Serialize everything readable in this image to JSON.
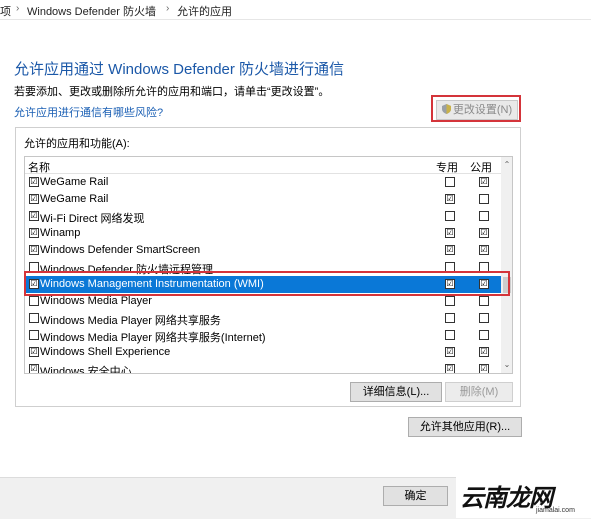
{
  "breadcrumb": [
    "项",
    "Windows Defender 防火墙",
    "允许的应用"
  ],
  "page_title": "允许应用通过 Windows Defender 防火墙进行通信",
  "subtitle": "若要添加、更改或删除所允许的应用和端口，请单击“更改设置”。",
  "risk_link": "允许应用进行通信有哪些风险?",
  "change_settings_label": "更改设置(N)",
  "group_label": "允许的应用和功能(A):",
  "columns": {
    "name": "名称",
    "private": "专用",
    "public": "公用"
  },
  "rows": [
    {
      "name": "WeGame Rail",
      "enabled": "☑",
      "private": "",
      "public": "☑"
    },
    {
      "name": "WeGame Rail",
      "enabled": "☑",
      "private": "☑",
      "public": ""
    },
    {
      "name": "Wi-Fi Direct 网络发现",
      "enabled": "☑",
      "private": "",
      "public": ""
    },
    {
      "name": "Winamp",
      "enabled": "☑",
      "private": "☑",
      "public": "☑"
    },
    {
      "name": "Windows Defender SmartScreen",
      "enabled": "☑",
      "private": "☑",
      "public": "☑"
    },
    {
      "name": "Windows Defender 防火墙远程管理",
      "enabled": "",
      "private": "",
      "public": ""
    },
    {
      "name": "Windows Management Instrumentation (WMI)",
      "enabled": "☑",
      "private": "☑",
      "public": "☑",
      "selected": true
    },
    {
      "name": "Windows Media Player",
      "enabled": "",
      "private": "",
      "public": ""
    },
    {
      "name": "Windows Media Player 网络共享服务",
      "enabled": "",
      "private": "",
      "public": ""
    },
    {
      "name": "Windows Media Player 网络共享服务(Internet)",
      "enabled": "",
      "private": "",
      "public": ""
    },
    {
      "name": "Windows Shell Experience",
      "enabled": "☑",
      "private": "☑",
      "public": "☑"
    },
    {
      "name": "Windows 安全中心",
      "enabled": "☑",
      "private": "☑",
      "public": "☑"
    }
  ],
  "details_button": "详细信息(L)...",
  "remove_button": "删除(M)",
  "allow_other_button": "允许其他应用(R)...",
  "ok_button": "确定",
  "watermark": {
    "main": "云南龙网",
    "url": "jiamalai.com"
  },
  "colors": {
    "title": "#1b58a8",
    "selection": "#0a78d7",
    "highlight_border": "#d4343a"
  }
}
